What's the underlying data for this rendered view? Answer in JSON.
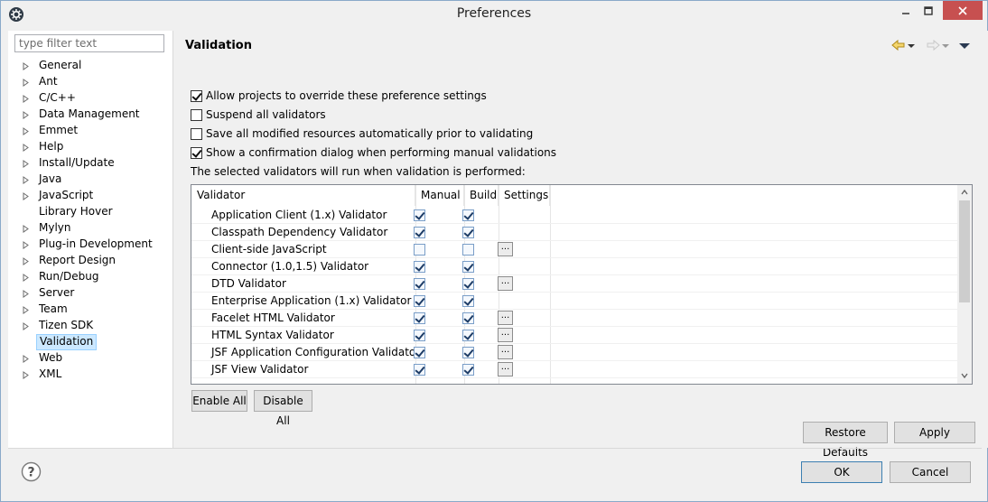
{
  "window": {
    "title": "Preferences",
    "icons": {
      "app": "eclipse-app-icon",
      "minimize": "minimize-icon",
      "maximize": "maximize-icon",
      "close": "close-icon"
    }
  },
  "sidebar": {
    "filter_placeholder": "type filter text",
    "items": [
      {
        "label": "General",
        "has_children": true
      },
      {
        "label": "Ant",
        "has_children": true
      },
      {
        "label": "C/C++",
        "has_children": true
      },
      {
        "label": "Data Management",
        "has_children": true
      },
      {
        "label": "Emmet",
        "has_children": true
      },
      {
        "label": "Help",
        "has_children": true
      },
      {
        "label": "Install/Update",
        "has_children": true
      },
      {
        "label": "Java",
        "has_children": true
      },
      {
        "label": "JavaScript",
        "has_children": true
      },
      {
        "label": "Library Hover",
        "has_children": false
      },
      {
        "label": "Mylyn",
        "has_children": true
      },
      {
        "label": "Plug-in Development",
        "has_children": true
      },
      {
        "label": "Report Design",
        "has_children": true
      },
      {
        "label": "Run/Debug",
        "has_children": true
      },
      {
        "label": "Server",
        "has_children": true
      },
      {
        "label": "Team",
        "has_children": true
      },
      {
        "label": "Tizen SDK",
        "has_children": true
      },
      {
        "label": "Validation",
        "has_children": false,
        "selected": true
      },
      {
        "label": "Web",
        "has_children": true
      },
      {
        "label": "XML",
        "has_children": true
      }
    ]
  },
  "main": {
    "title": "Validation",
    "nav_icons": [
      "back-arrow-icon",
      "back-menu-icon",
      "forward-arrow-icon",
      "forward-menu-icon",
      "view-menu-icon"
    ],
    "options": [
      {
        "label": "Allow projects to override these preference settings",
        "checked": true
      },
      {
        "label": "Suspend all validators",
        "checked": false
      },
      {
        "label": "Save all modified resources automatically prior to validating",
        "checked": false
      },
      {
        "label": "Show a confirmation dialog when performing manual validations",
        "checked": true
      }
    ],
    "note": "The selected validators will run when validation is performed:",
    "table": {
      "columns": [
        "Validator",
        "Manual",
        "Build",
        "Settings"
      ],
      "rows": [
        {
          "name": "Application Client (1.x) Validator",
          "manual": true,
          "build": true,
          "settings": false
        },
        {
          "name": "Classpath Dependency Validator",
          "manual": true,
          "build": true,
          "settings": false
        },
        {
          "name": "Client-side JavaScript",
          "manual": false,
          "build": false,
          "settings": true
        },
        {
          "name": "Connector (1.0,1.5) Validator",
          "manual": true,
          "build": true,
          "settings": false
        },
        {
          "name": "DTD Validator",
          "manual": true,
          "build": true,
          "settings": true
        },
        {
          "name": "Enterprise Application (1.x) Validator",
          "manual": true,
          "build": true,
          "settings": false
        },
        {
          "name": "Facelet HTML Validator",
          "manual": true,
          "build": true,
          "settings": true
        },
        {
          "name": "HTML Syntax Validator",
          "manual": true,
          "build": true,
          "settings": true
        },
        {
          "name": "JSF Application Configuration Validator",
          "manual": true,
          "build": true,
          "settings": true
        },
        {
          "name": "JSF View Validator",
          "manual": true,
          "build": true,
          "settings": true
        }
      ],
      "settings_button_label": "..."
    },
    "enable_all": "Enable All",
    "disable_all": "Disable All",
    "restore_defaults": "Restore Defaults",
    "apply": "Apply"
  },
  "footer": {
    "help_icon": "help-icon",
    "ok": "OK",
    "cancel": "Cancel"
  }
}
